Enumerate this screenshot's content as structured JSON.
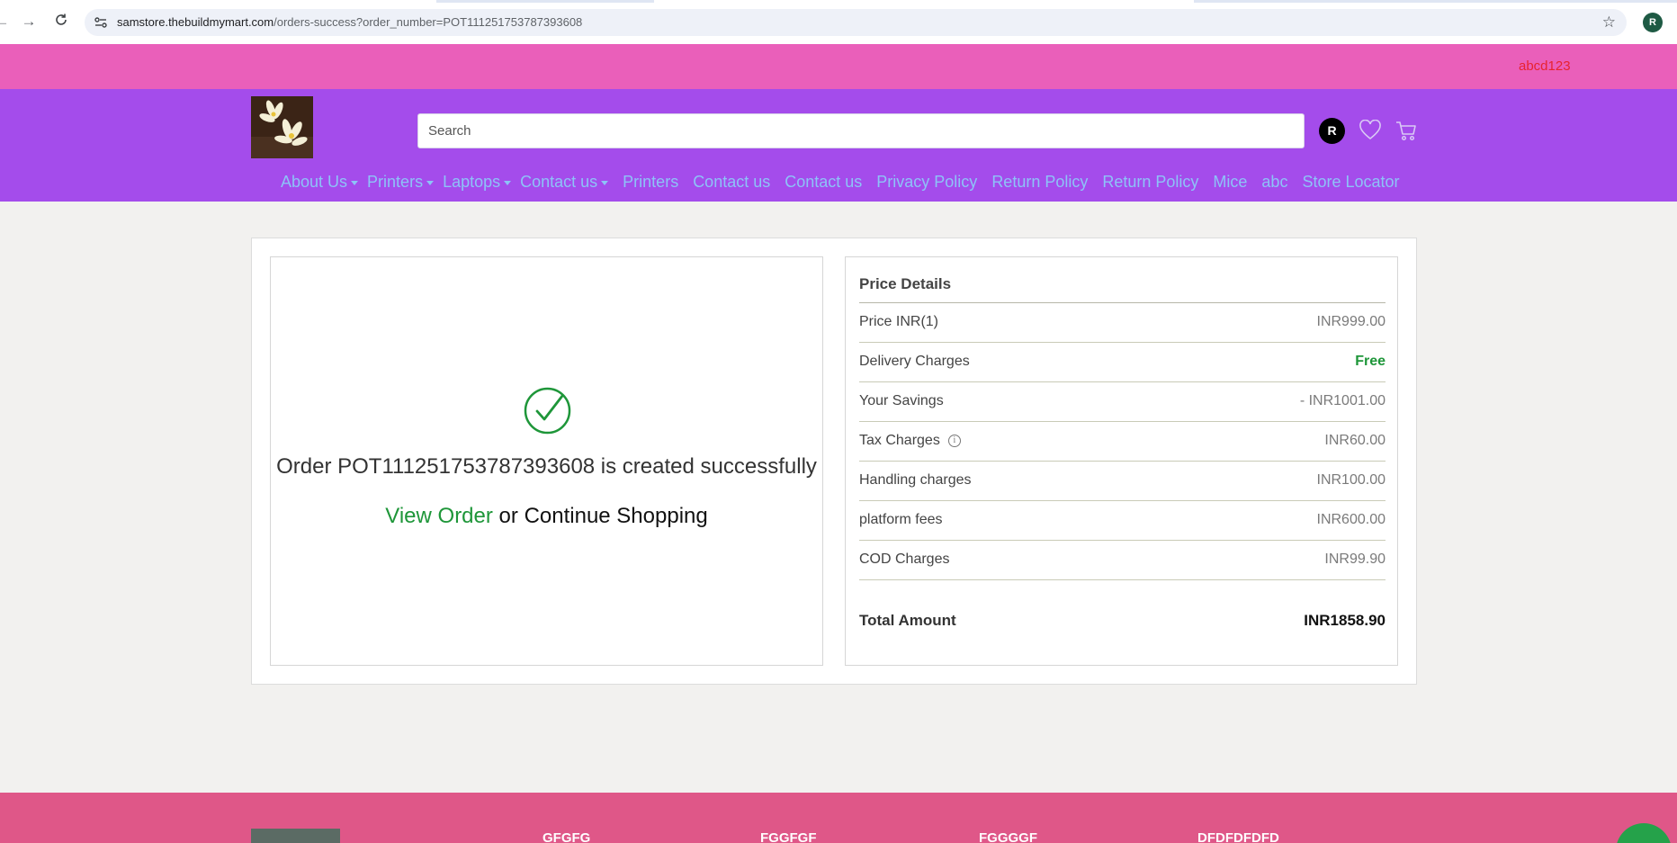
{
  "browser": {
    "url_host": "samstore.thebuildmymart.com",
    "url_path": "/orders-success?order_number=POT111251753787393608",
    "profile_initial": "R"
  },
  "topbar": {
    "user": "abcd123"
  },
  "header": {
    "search_placeholder": "Search",
    "avatar_initial": "R",
    "menu": [
      {
        "label": "About Us",
        "dropdown": true
      },
      {
        "label": "Printers",
        "dropdown": true
      },
      {
        "label": "Laptops",
        "dropdown": true
      },
      {
        "label": "Contact us",
        "dropdown": true
      },
      {
        "label": "Printers",
        "dropdown": false
      },
      {
        "label": "Contact us",
        "dropdown": false
      },
      {
        "label": "Contact us",
        "dropdown": false
      },
      {
        "label": "Privacy Policy",
        "dropdown": false
      },
      {
        "label": "Return Policy",
        "dropdown": false
      },
      {
        "label": "Return Policy",
        "dropdown": false
      },
      {
        "label": "Mice",
        "dropdown": false
      },
      {
        "label": "abc",
        "dropdown": false
      },
      {
        "label": "Store Locator",
        "dropdown": false
      }
    ]
  },
  "order": {
    "message": "Order POT111251753787393608 is created successfully",
    "view_order": "View Order",
    "or": " or ",
    "continue_shopping": "Continue Shopping"
  },
  "price_details": {
    "title": "Price Details",
    "rows": [
      {
        "label": "Price INR(1)",
        "value": "INR999.00"
      },
      {
        "label": "Delivery Charges",
        "value": "Free"
      },
      {
        "label": "Your Savings",
        "value": "- INR1001.00"
      },
      {
        "label": "Tax Charges",
        "value": "INR60.00"
      },
      {
        "label": "Handling charges",
        "value": "INR100.00"
      },
      {
        "label": "platform fees",
        "value": "INR600.00"
      },
      {
        "label": "COD Charges",
        "value": "INR99.90"
      }
    ],
    "total_label": "Total Amount",
    "total_value": "INR1858.90"
  },
  "footer": {
    "headings": [
      "GFGFG",
      "FGGFGF",
      "FGGGGF",
      "DFDFDFDFD"
    ]
  },
  "colors": {
    "topbar": "#ea5fba",
    "header": "#a44ceb",
    "menu_link": "#8dc3f7",
    "success_green": "#1e9639",
    "footer": "#df5788"
  }
}
